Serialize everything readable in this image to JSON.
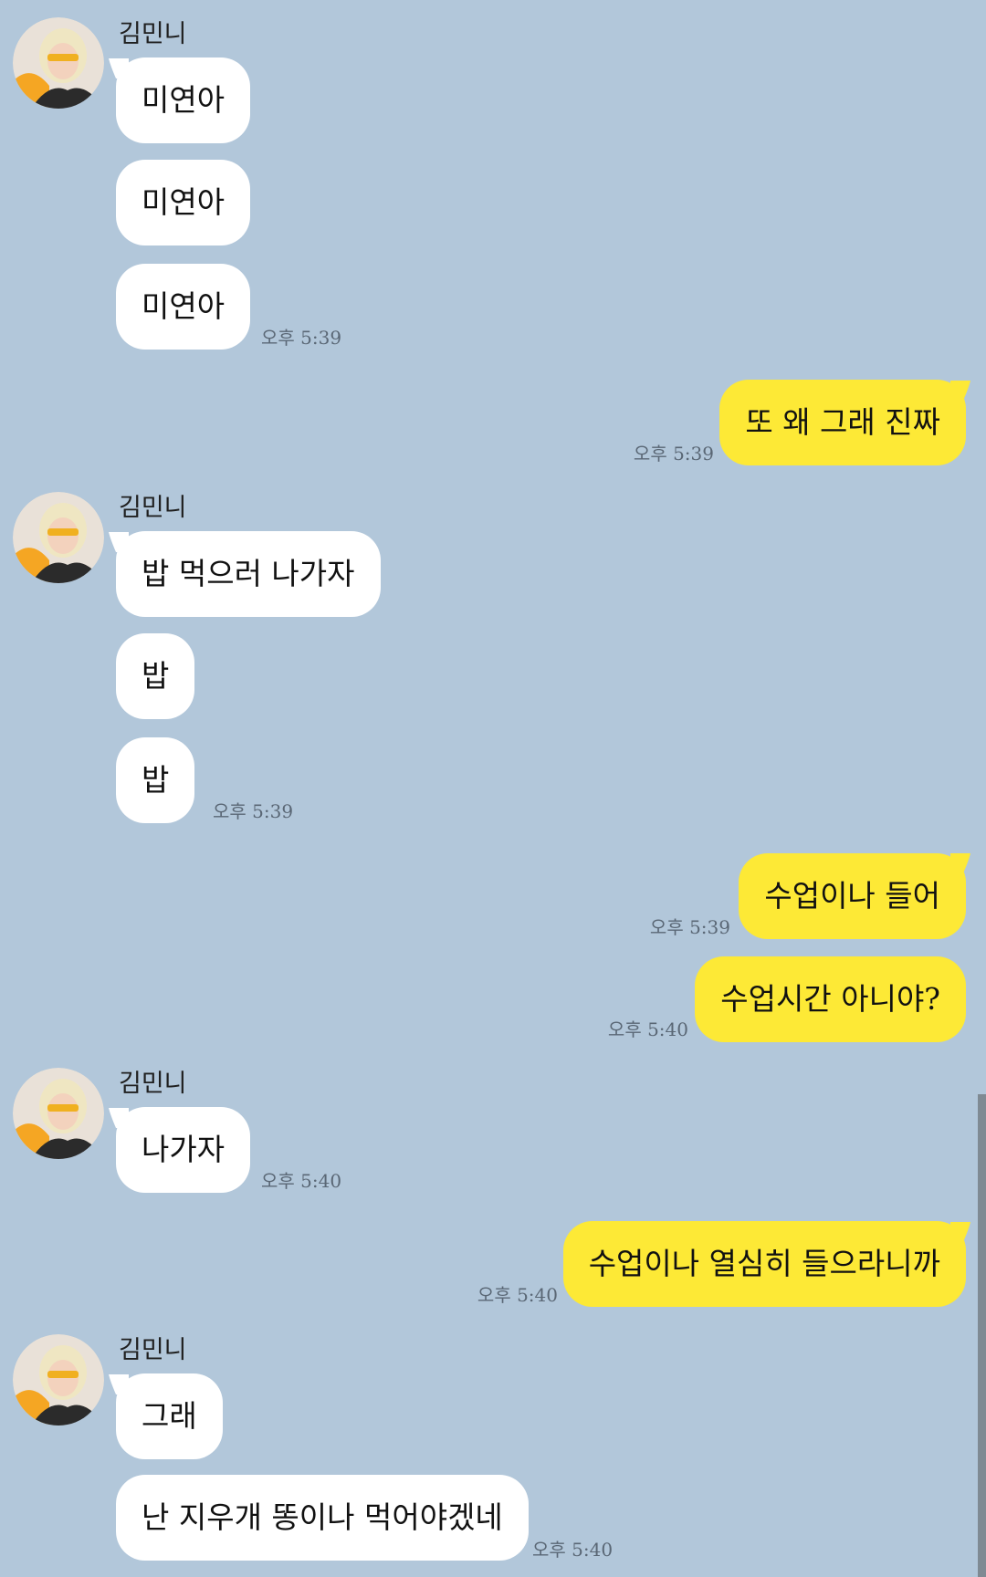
{
  "chat": {
    "partner_name": "김민니",
    "groups": [
      {
        "sender": "김민니",
        "messages": [
          "미연아",
          "미연아",
          "미연아"
        ],
        "time": "오후 5:39"
      },
      {
        "sender": "me",
        "messages": [
          {
            "text": "또 왜 그래 진짜",
            "time": "오후 5:39"
          }
        ]
      },
      {
        "sender": "김민니",
        "messages": [
          "밥 먹으러 나가자",
          "밥",
          "밥"
        ],
        "time": "오후 5:39"
      },
      {
        "sender": "me",
        "messages": [
          {
            "text": "수업이나 들어",
            "time": "오후 5:39"
          },
          {
            "text": "수업시간 아니야?",
            "time": "오후 5:40"
          }
        ]
      },
      {
        "sender": "김민니",
        "messages": [
          "나가자"
        ],
        "time": "오후 5:40"
      },
      {
        "sender": "me",
        "messages": [
          {
            "text": "수업이나 열심히 들으라니까",
            "time": "오후 5:40"
          }
        ]
      },
      {
        "sender": "김민니",
        "messages": [
          "그래",
          "난 지우개 똥이나 먹어야겠네"
        ],
        "time": "오후 5:40"
      }
    ]
  },
  "avatar": {
    "icon": "profile-photo-avatar",
    "description_colors": [
      "#f5a623",
      "#efe6c2",
      "#2b2b2b"
    ]
  },
  "colors": {
    "background": "#b2c7da",
    "incoming_bubble": "#ffffff",
    "outgoing_bubble": "#fde936",
    "timestamp": "#5a6775"
  }
}
